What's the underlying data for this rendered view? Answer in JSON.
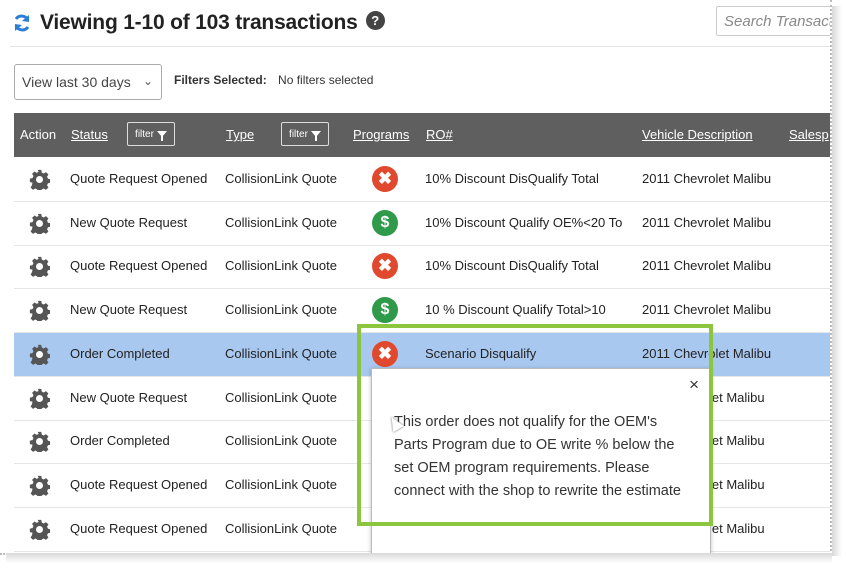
{
  "header": {
    "title": "Viewing 1-10 of 103 transactions",
    "help": "?",
    "search_placeholder": "Search Transactions"
  },
  "toolbar": {
    "range": "View last 30 days",
    "filters_label": "Filters Selected:",
    "filters_value": "No filters selected"
  },
  "columns": {
    "action": "Action",
    "status": "Status",
    "type": "Type",
    "programs": "Programs",
    "ro": "RO#",
    "vehicle": "Vehicle Description",
    "sales": "Salesp",
    "filter_btn": "filter"
  },
  "rows": [
    {
      "status": "Quote Request Opened",
      "type": "CollisionLink Quote",
      "program": "disqualify",
      "program_icon": "✖",
      "ro": "10% Discount DisQualify Total",
      "vehicle": "2011 Chevrolet Malibu"
    },
    {
      "status": "New Quote Request",
      "type": "CollisionLink Quote",
      "program": "qualify",
      "program_icon": "$",
      "ro": "10% Discount Qualify OE%<20 To",
      "vehicle": "2011 Chevrolet Malibu"
    },
    {
      "status": "Quote Request Opened",
      "type": "CollisionLink Quote",
      "program": "disqualify",
      "program_icon": "✖",
      "ro": "10% Discount DisQualify Total",
      "vehicle": "2011 Chevrolet Malibu"
    },
    {
      "status": "New Quote Request",
      "type": "CollisionLink Quote",
      "program": "qualify",
      "program_icon": "$",
      "ro": "10 % Discount Qualify Total>10",
      "vehicle": "2011 Chevrolet Malibu"
    },
    {
      "status": "Order Completed",
      "type": "CollisionLink Quote",
      "program": "disqualify",
      "program_icon": "✖",
      "ro": "Scenario Disqualify",
      "vehicle": "2011 Chevrolet Malibu"
    },
    {
      "status": "New Quote Request",
      "type": "CollisionLink Quote",
      "program": "",
      "program_icon": "",
      "ro": "",
      "vehicle": "let Malibu"
    },
    {
      "status": "Order Completed",
      "type": "CollisionLink Quote",
      "program": "",
      "program_icon": "",
      "ro": "",
      "vehicle": "let Malibu"
    },
    {
      "status": "Quote Request Opened",
      "type": "CollisionLink Quote",
      "program": "",
      "program_icon": "",
      "ro": "",
      "vehicle": "let Malibu"
    },
    {
      "status": "Quote Request Opened",
      "type": "CollisionLink Quote",
      "program": "",
      "program_icon": "",
      "ro": "",
      "vehicle": "let Malibu"
    }
  ],
  "popup": {
    "close": "×",
    "message": "This order does not qualify for the OEM's Parts Program due to OE write % below the set OEM program requirements. Please connect with the shop to rewrite the estimate"
  },
  "colors": {
    "header_bg": "#5f5f5f",
    "selected_row": "#a9c8ef",
    "disqualify": "#e0492e",
    "qualify": "#2f9a4a",
    "highlight": "#8cc63e",
    "refresh": "#2b7fd6"
  }
}
